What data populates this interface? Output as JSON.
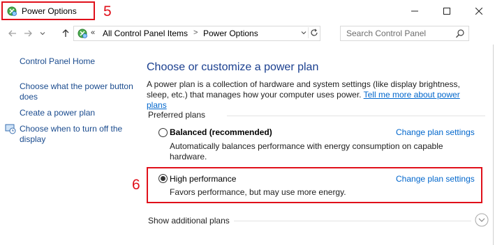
{
  "window": {
    "title": "Power Options",
    "annotation_title": "5",
    "annotation_plan": "6"
  },
  "address": {
    "chevrons": "«",
    "crumbs": [
      "All Control Panel Items",
      "Power Options"
    ],
    "separator": ">",
    "search_placeholder": "Search Control Panel"
  },
  "left_pane": {
    "home": "Control Panel Home",
    "links": [
      "Choose what the power button does",
      "Create a power plan",
      "Choose when to turn off the display"
    ]
  },
  "main": {
    "heading": "Choose or customize a power plan",
    "description": "A power plan is a collection of hardware and system settings (like display brightness, sleep, etc.) that manages how your computer uses power.",
    "tell_me_more": "Tell me more about power plans",
    "preferred_label": "Preferred plans",
    "plans": [
      {
        "name": "Balanced (recommended)",
        "description": "Automatically balances performance with energy consumption on capable hardware.",
        "change_link": "Change plan settings",
        "selected": false
      },
      {
        "name": "High performance",
        "description": "Favors performance, but may use more energy.",
        "change_link": "Change plan settings",
        "selected": true
      }
    ],
    "show_additional": "Show additional plans"
  },
  "colors": {
    "annotation": "#e0101a",
    "link": "#0066cc",
    "heading": "#1a3f8f"
  }
}
